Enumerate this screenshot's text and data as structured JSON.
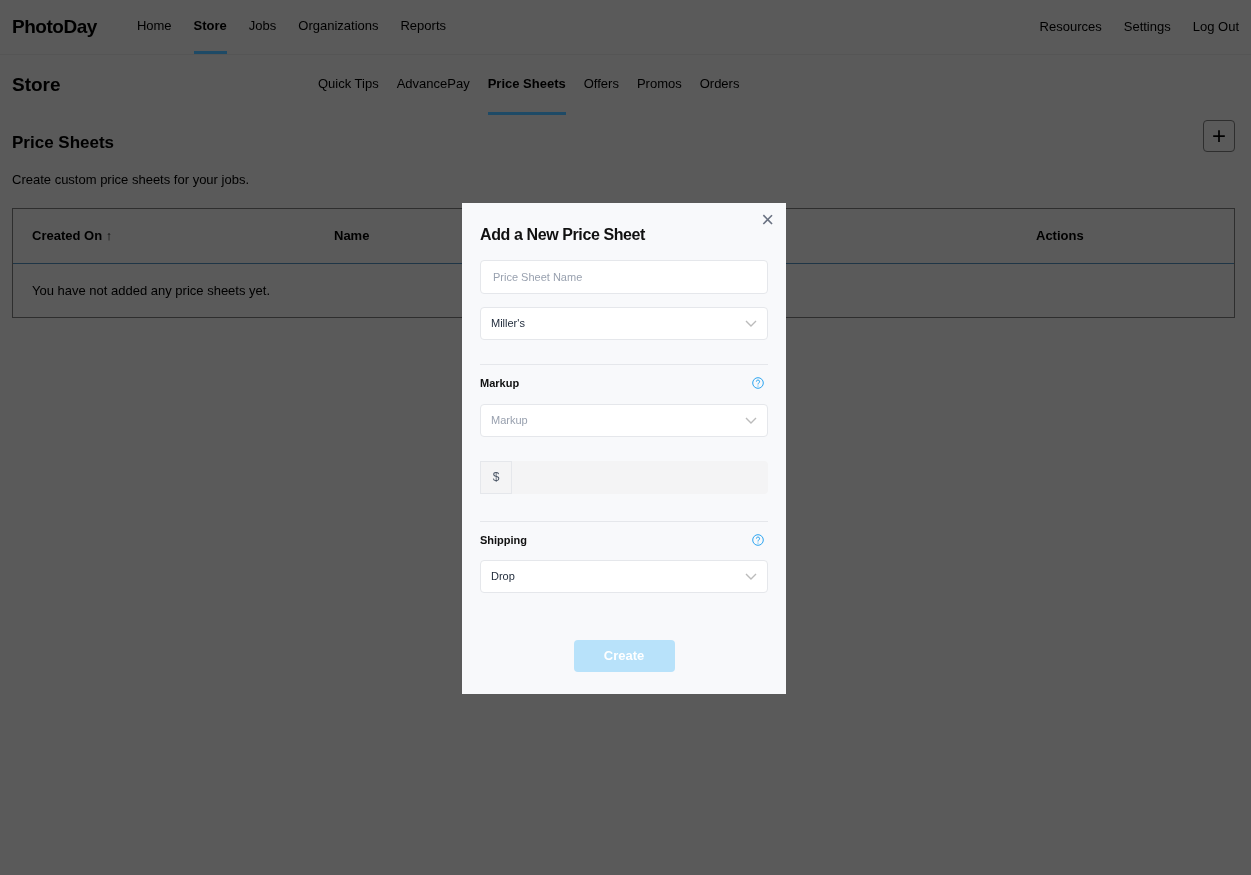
{
  "logo": "PhotoDay",
  "nav": [
    {
      "label": "Home",
      "selected": false
    },
    {
      "label": "Store",
      "selected": true
    },
    {
      "label": "Jobs",
      "selected": false
    },
    {
      "label": "Organizations",
      "selected": false
    },
    {
      "label": "Reports",
      "selected": false
    }
  ],
  "nav_right": [
    "Resources",
    "Settings",
    "Log Out"
  ],
  "page_title": "Store",
  "subnav": [
    {
      "label": "Quick Tips",
      "selected": false
    },
    {
      "label": "AdvancePay",
      "selected": false
    },
    {
      "label": "Price Sheets",
      "selected": true
    },
    {
      "label": "Offers",
      "selected": false
    },
    {
      "label": "Promos",
      "selected": false
    },
    {
      "label": "Orders",
      "selected": false
    }
  ],
  "section": {
    "title": "Price Sheets",
    "description": "Create custom price sheets for your jobs.",
    "add_button": "+"
  },
  "table": {
    "columns": [
      "Created On ↑",
      "Name",
      "Actions"
    ],
    "empty_message": "You have not added any price sheets yet."
  },
  "modal": {
    "title": "Add a New Price Sheet",
    "close": "×",
    "name_field": {
      "placeholder": "Price Sheet Name"
    },
    "lab_select": {
      "value": "Miller's"
    },
    "markup": {
      "label": "Markup",
      "select": {
        "placeholder": "Markup"
      },
      "currency": "$"
    },
    "shipping": {
      "label": "Shipping",
      "select": {
        "value": "Drop"
      }
    },
    "create_button": {
      "label": "Create",
      "disabled": true
    }
  }
}
